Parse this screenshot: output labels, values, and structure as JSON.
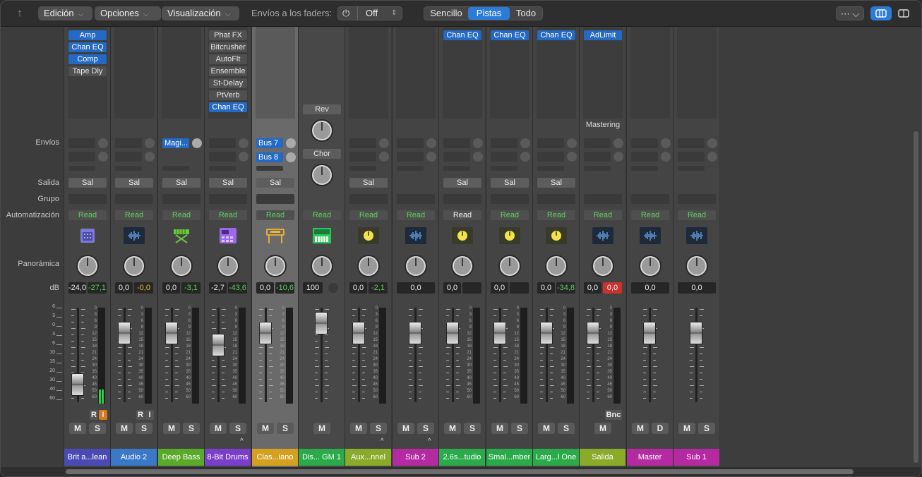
{
  "toolbar": {
    "back_icon": "return-arrow-icon",
    "menus": [
      {
        "label": "Edición"
      },
      {
        "label": "Opciones"
      },
      {
        "label": "Visualización"
      }
    ],
    "faders_label": "Envíos a los faders:",
    "faders_power_icon": "power-icon",
    "faders_value": "Off",
    "view_modes": [
      {
        "label": "Sencillo",
        "selected": false
      },
      {
        "label": "Pistas",
        "selected": true
      },
      {
        "label": "Todo",
        "selected": false
      }
    ],
    "more_icon": "ellipsis-circle-icon",
    "layout_icons": [
      "mixer-layout-icon",
      "split-layout-icon"
    ]
  },
  "row_labels": {
    "sends": "Envíos",
    "output": "Salida",
    "group": "Grupo",
    "automation": "Automatización",
    "pan": "Panorámica",
    "db": "dB"
  },
  "scale": {
    "sidebar": [
      "6",
      "3",
      "0",
      "3",
      "6",
      "10",
      "15",
      "20",
      "30",
      "40",
      "60"
    ],
    "strip": [
      "0",
      "3",
      "6",
      "9",
      "12",
      "15",
      "18",
      "21",
      "24",
      "30",
      "35",
      "40",
      "45",
      "50",
      "60"
    ]
  },
  "channels": [
    {
      "name": "Brit a...lean",
      "color": "#4a4ab4",
      "inserts": [
        {
          "label": "Amp",
          "blue": true
        },
        {
          "label": "Chan EQ",
          "blue": true
        },
        {
          "label": "Comp",
          "blue": true
        },
        {
          "label": "Tape Dly",
          "blue": false
        }
      ],
      "output": "Sal",
      "automation": "Read",
      "icon": "amp-icon",
      "db": [
        "-24,0",
        "-27,1"
      ],
      "db_colors": [
        "",
        "green"
      ],
      "fader_level": 0.2,
      "meter_level": 0.15,
      "buttons": [
        "M",
        "S"
      ],
      "ri": [
        "R",
        "I"
      ]
    },
    {
      "name": "Audio 2",
      "color": "#3a78c8",
      "inserts": [],
      "output": "Sal",
      "automation": "Read",
      "icon": "waveform-icon",
      "db": [
        "0,0",
        "-0,0"
      ],
      "db_colors": [
        "",
        "yellow"
      ],
      "fader_level": 0.75,
      "buttons": [
        "M",
        "S"
      ],
      "ri": [
        "R",
        "I"
      ]
    },
    {
      "name": "Deep Bass",
      "color": "#5aaa2a",
      "inserts": [],
      "send": "Magi...",
      "output": "Sal",
      "automation": "Read",
      "icon": "keyboard-stand-icon",
      "db": [
        "0,0",
        "-3,1"
      ],
      "db_colors": [
        "",
        "green"
      ],
      "fader_level": 0.75,
      "buttons": [
        "M",
        "S"
      ]
    },
    {
      "name": "8-Bit Drums",
      "color": "#7a3ec8",
      "inserts": [
        {
          "label": "Phat FX",
          "blue": false
        },
        {
          "label": "Bitcrusher",
          "blue": false
        },
        {
          "label": "AutoFlt",
          "blue": false
        },
        {
          "label": "Ensemble",
          "blue": false
        },
        {
          "label": "St-Delay",
          "blue": false
        },
        {
          "label": "PtVerb",
          "blue": false
        },
        {
          "label": "Chan EQ",
          "blue": true
        }
      ],
      "output": "Sal",
      "automation": "Read",
      "icon": "drum-machine-icon",
      "db": [
        "-2,7",
        "-43,6"
      ],
      "db_colors": [
        "",
        "green"
      ],
      "fader_level": 0.62,
      "buttons": [
        "M",
        "S"
      ],
      "caret": true
    },
    {
      "name": "Clas...iano",
      "color": "#d4a020",
      "inserts": [],
      "sends": [
        "Bus 7",
        "Bus 8"
      ],
      "output": "Sal",
      "automation": "Read",
      "icon": "piano-icon",
      "db": [
        "0,0",
        "-10,6"
      ],
      "db_colors": [
        "",
        "green"
      ],
      "fader_level": 0.75,
      "buttons": [
        "M",
        "S"
      ],
      "selected": true
    },
    {
      "name": "Dis... GM 1",
      "color": "#2aaa4a",
      "inserts": [],
      "knob_sends": [
        "Rev",
        "Chor"
      ],
      "automation": "Read",
      "icon": "synth-icon",
      "db": [
        "100"
      ],
      "db_colors": [
        ""
      ],
      "fader_level": 0.85,
      "buttons": [
        "M"
      ]
    },
    {
      "name": "Aux...nnel",
      "color": "#8aaa2a",
      "inserts": [],
      "output": "Sal",
      "automation": "Read",
      "icon": "aux-knob-icon",
      "db": [
        "0,0",
        "-2,1"
      ],
      "db_colors": [
        "",
        "green"
      ],
      "fader_level": 0.75,
      "buttons": [
        "M",
        "S"
      ],
      "caret": true
    },
    {
      "name": "Sub 2",
      "color": "#b42aa0",
      "inserts": [],
      "automation": "Read",
      "icon": "waveform-icon",
      "db": [
        "0,0"
      ],
      "db_colors": [
        ""
      ],
      "fader_level": 0.75,
      "buttons": [
        "M",
        "S"
      ],
      "caret": true
    },
    {
      "name": "2.6s...tudio",
      "color": "#2aaa4a",
      "inserts": [
        {
          "label": "Chan EQ",
          "blue": true
        }
      ],
      "output": "Sal",
      "automation": "Read",
      "automation_white": true,
      "icon": "aux-knob-icon",
      "db": [
        "0,0",
        ""
      ],
      "db_colors": [
        "",
        ""
      ],
      "fader_level": 0.75,
      "buttons": [
        "M",
        "S"
      ]
    },
    {
      "name": "Smal...mber",
      "color": "#2aaa4a",
      "inserts": [
        {
          "label": "Chan EQ",
          "blue": true
        }
      ],
      "output": "Sal",
      "automation": "Read",
      "icon": "aux-knob-icon",
      "db": [
        "0,0",
        ""
      ],
      "db_colors": [
        "",
        ""
      ],
      "fader_level": 0.75,
      "buttons": [
        "M",
        "S"
      ]
    },
    {
      "name": "Larg...l One",
      "color": "#2aaa4a",
      "inserts": [
        {
          "label": "Chan EQ",
          "blue": true
        }
      ],
      "output": "Sal",
      "automation": "Read",
      "icon": "aux-knob-icon",
      "db": [
        "0,0",
        "-34,8"
      ],
      "db_colors": [
        "",
        "green"
      ],
      "fader_level": 0.75,
      "buttons": [
        "M",
        "S"
      ]
    },
    {
      "name": "Salida",
      "color": "#8aaa2a",
      "inserts": [
        {
          "label": "AdLimit",
          "blue": true
        }
      ],
      "insert_footer": "Mastering",
      "automation": "Read",
      "icon": "waveform-icon",
      "db": [
        "0,0",
        "0,0"
      ],
      "db_colors": [
        "",
        "red"
      ],
      "fader_level": 0.75,
      "buttons": [
        "M"
      ],
      "bnc": "Bnc"
    },
    {
      "name": "Master",
      "color": "#b42aa0",
      "inserts": [],
      "automation": "Read",
      "icon": "waveform-icon",
      "db": [
        "0,0"
      ],
      "db_colors": [
        ""
      ],
      "fader_level": 0.75,
      "buttons": [
        "M",
        "D"
      ]
    },
    {
      "name": "Sub 1",
      "color": "#b42aa0",
      "inserts": [],
      "automation": "Read",
      "icon": "waveform-icon",
      "db": [
        "0,0"
      ],
      "db_colors": [
        ""
      ],
      "fader_level": 0.75,
      "buttons": [
        "M",
        "S"
      ]
    }
  ]
}
